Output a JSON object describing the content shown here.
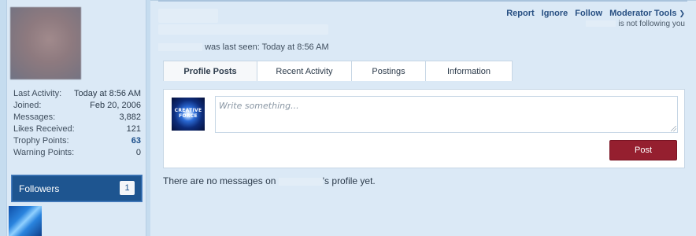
{
  "sidebar": {
    "stats": [
      {
        "label": "Last Activity:",
        "value": "Today at 8:56 AM"
      },
      {
        "label": "Joined:",
        "value": "Feb 20, 2006"
      },
      {
        "label": "Messages:",
        "value": "3,882"
      },
      {
        "label": "Likes Received:",
        "value": "121"
      },
      {
        "label": "Trophy Points:",
        "value": "63"
      },
      {
        "label": "Warning Points:",
        "value": "0"
      }
    ],
    "followers": {
      "title": "Followers",
      "count": "1"
    }
  },
  "header": {
    "actions": {
      "report": "Report",
      "ignore": "Ignore",
      "follow": "Follow",
      "moderator_tools": "Moderator Tools"
    },
    "not_following": "is not following you",
    "last_seen_text": "was last seen:",
    "last_seen_value": "Today at 8:56 AM"
  },
  "tabs": [
    {
      "label": "Profile Posts"
    },
    {
      "label": "Recent Activity"
    },
    {
      "label": "Postings"
    },
    {
      "label": "Information"
    }
  ],
  "post_box": {
    "avatar_text_1": "CREATIVE",
    "avatar_text_2": "FORCE",
    "placeholder": "Write something...",
    "post_button": "Post"
  },
  "no_messages": {
    "before": "There are no messages on",
    "after": "'s profile yet."
  },
  "colors": {
    "accent_blue": "#1e5590",
    "post_button": "#951f2f",
    "background": "#c5dcef"
  }
}
